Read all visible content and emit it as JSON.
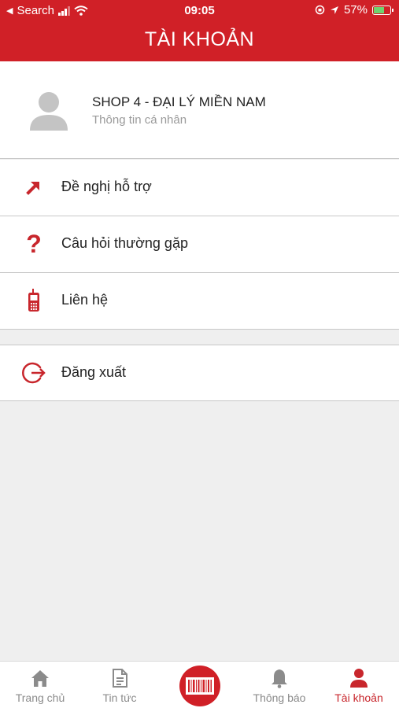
{
  "status": {
    "back_label": "Search",
    "time": "09:05",
    "battery": "57%",
    "battery_level": 0.57
  },
  "header": {
    "title": "TÀI KHOẢN"
  },
  "profile": {
    "name": "SHOP 4 - ĐẠI LÝ MIỀN NAM",
    "subtitle": "Thông tin cá nhân"
  },
  "menu": [
    {
      "label": "Đề nghị hỗ trợ",
      "icon": "arrow-up-right-icon"
    },
    {
      "label": "Câu hỏi thường gặp",
      "icon": "question-icon"
    },
    {
      "label": "Liên hệ",
      "icon": "phone-icon"
    },
    {
      "label": "Đăng xuất",
      "icon": "logout-icon"
    }
  ],
  "tabs": [
    {
      "label": "Trang chủ",
      "icon": "home-icon"
    },
    {
      "label": "Tin tức",
      "icon": "document-icon"
    },
    {
      "label": "",
      "icon": "barcode-icon"
    },
    {
      "label": "Thông báo",
      "icon": "bell-icon"
    },
    {
      "label": "Tài khoản",
      "icon": "user-icon",
      "active": true
    }
  ],
  "colors": {
    "brand": "#d02027",
    "accent": "#c8262c",
    "inactive": "#8b8b8b"
  }
}
